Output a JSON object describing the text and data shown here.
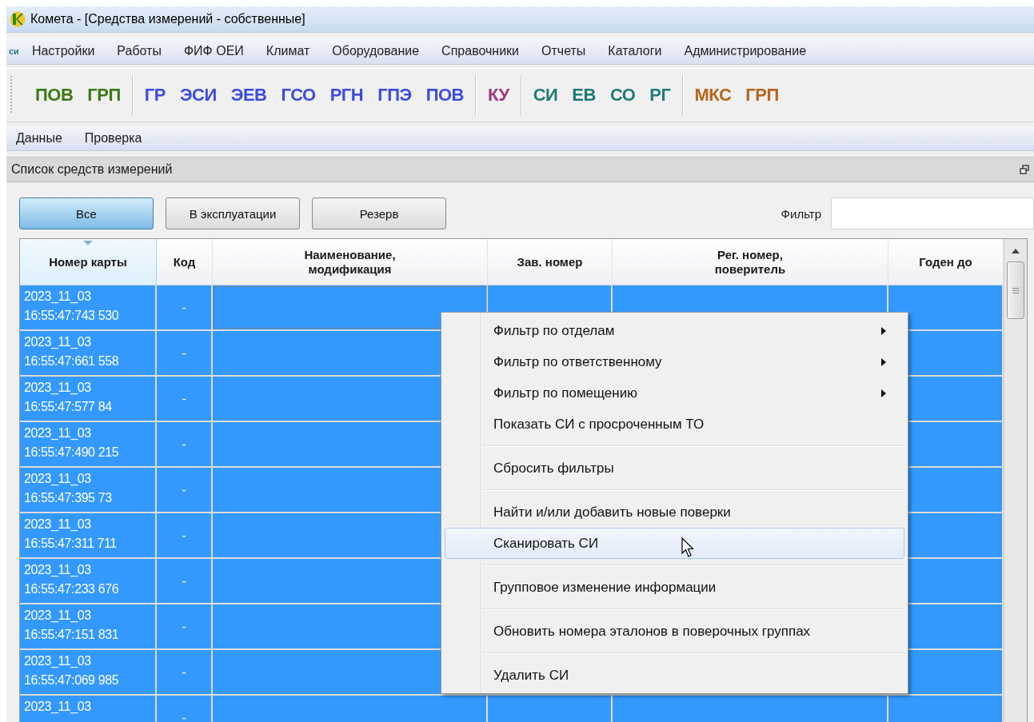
{
  "window": {
    "title": "Комета - [Средства измерений - собственные]"
  },
  "menubar": {
    "badge": "си",
    "items": [
      "Настройки",
      "Работы",
      "ФИФ ОЕИ",
      "Климат",
      "Оборудование",
      "Справочники",
      "Отчеты",
      "Каталоги",
      "Администрирование"
    ]
  },
  "toolbar": {
    "groups": [
      {
        "items": [
          {
            "label": "ПОВ",
            "color": "#3b7a17"
          },
          {
            "label": "ГРП",
            "color": "#3b7a17"
          }
        ]
      },
      {
        "items": [
          {
            "label": "ГР",
            "color": "#3c4de0"
          },
          {
            "label": "ЭСИ",
            "color": "#3c4de0"
          },
          {
            "label": "ЭЕВ",
            "color": "#3c4de0"
          },
          {
            "label": "ГСО",
            "color": "#3c4de0"
          },
          {
            "label": "РГН",
            "color": "#3c4de0"
          },
          {
            "label": "ГПЭ",
            "color": "#3c4de0"
          },
          {
            "label": "ПОВ",
            "color": "#3c4de0"
          }
        ]
      },
      {
        "items": [
          {
            "label": "КУ",
            "color": "#a23579"
          }
        ]
      },
      {
        "items": [
          {
            "label": "СИ",
            "color": "#1e7c78"
          },
          {
            "label": "ЕВ",
            "color": "#1e7c78"
          },
          {
            "label": "СО",
            "color": "#1e7c78"
          },
          {
            "label": "РГ",
            "color": "#1e7c78"
          }
        ]
      },
      {
        "items": [
          {
            "label": "МКС",
            "color": "#b6661f"
          },
          {
            "label": "ГРП",
            "color": "#b6661f"
          }
        ]
      }
    ]
  },
  "submenu": [
    "Данные",
    "Проверка"
  ],
  "panel": {
    "title": "Список средств измерений"
  },
  "filter_buttons": [
    {
      "label": "Все",
      "selected": true
    },
    {
      "label": "В эксплуатации",
      "selected": false
    },
    {
      "label": "Резерв",
      "selected": false
    }
  ],
  "filter": {
    "label": "Фильтр"
  },
  "table": {
    "columns": [
      {
        "label": "Номер карты",
        "sorted": true
      },
      {
        "label": "Код",
        "sorted": false
      },
      {
        "label": "Наименование,\nмодификация",
        "sorted": false
      },
      {
        "label": "Зав. номер",
        "sorted": false
      },
      {
        "label": "Рег. номер,\nповеритель",
        "sorted": false
      },
      {
        "label": "Годен до",
        "sorted": false
      }
    ],
    "rows": [
      {
        "card": "2023_11_03\n16:55:47:743 530",
        "code": "-",
        "selected": true
      },
      {
        "card": "2023_11_03\n16:55:47:661 558",
        "code": "-",
        "selected": true
      },
      {
        "card": "2023_11_03\n16:55:47:577 84",
        "code": "-",
        "selected": true
      },
      {
        "card": "2023_11_03\n16:55:47:490 215",
        "code": "-",
        "selected": true
      },
      {
        "card": "2023_11_03\n16:55:47:395 73",
        "code": "-",
        "selected": true
      },
      {
        "card": "2023_11_03\n16:55:47:311 711",
        "code": "-",
        "selected": true
      },
      {
        "card": "2023_11_03\n16:55:47:233 676",
        "code": "-",
        "selected": true
      },
      {
        "card": "2023_11_03\n16:55:47:151 831",
        "code": "-",
        "selected": true
      },
      {
        "card": "2023_11_03\n16:55:47:069 985",
        "code": "-",
        "selected": true
      },
      {
        "card": "2023_11_03",
        "code": "-",
        "selected": true
      }
    ]
  },
  "context_menu": {
    "groups": [
      [
        {
          "label": "Фильтр по отделам",
          "submenu": true,
          "selected": false
        },
        {
          "label": "Фильтр по ответственному",
          "submenu": true,
          "selected": false
        },
        {
          "label": "Фильтр по помещению",
          "submenu": true,
          "selected": false
        },
        {
          "label": "Показать СИ с просроченным ТО",
          "submenu": false,
          "selected": false
        }
      ],
      [
        {
          "label": "Сбросить фильтры",
          "submenu": false,
          "selected": false
        }
      ],
      [
        {
          "label": "Найти и/или добавить новые поверки",
          "submenu": false,
          "selected": false
        },
        {
          "label": "Сканировать СИ",
          "submenu": false,
          "selected": true
        }
      ],
      [
        {
          "label": "Групповое изменение информации",
          "submenu": false,
          "selected": false
        }
      ],
      [
        {
          "label": "Обновить номера эталонов в поверочных группах",
          "submenu": false,
          "selected": false
        }
      ],
      [
        {
          "label": "Удалить СИ",
          "submenu": false,
          "selected": false
        }
      ]
    ]
  }
}
